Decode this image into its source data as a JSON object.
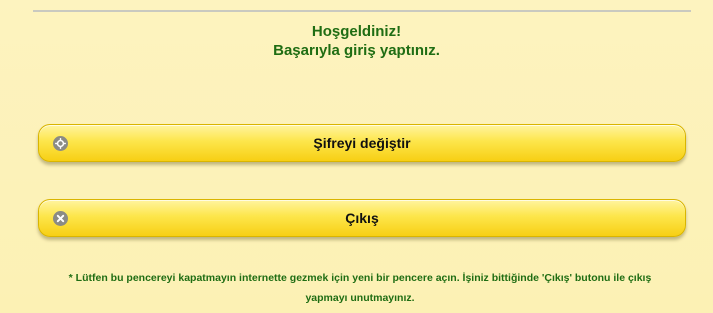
{
  "welcome": {
    "title": "Hoşgeldiniz!",
    "subtitle": "Başarıyla giriş yaptınız."
  },
  "actions": {
    "change_password": {
      "label": "Şifreyi değiştir",
      "icon": "gear-icon"
    },
    "logout": {
      "label": "Çıkış",
      "icon": "close-icon"
    }
  },
  "note": {
    "line1": "* Lütfen bu pencereyi kapatmayın internette gezmek için yeni bir pencere açın. İşiniz bittiğinde 'Çıkış' butonu ile çıkış",
    "line2": "yapmayı unutmayınız."
  },
  "colors": {
    "background": "#fcf2b8",
    "text_green": "#1f6d13",
    "button_yellow": "#fde64b",
    "icon_gray": "#8b8b85"
  }
}
